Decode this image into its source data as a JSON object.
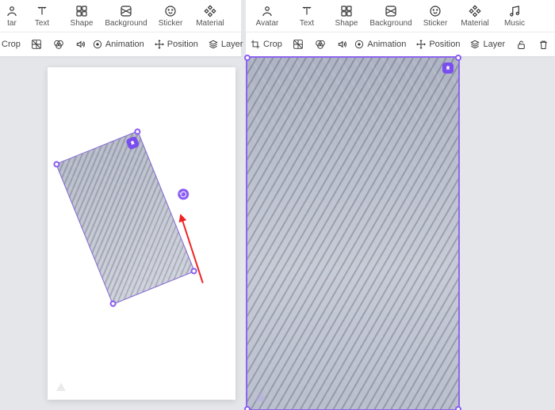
{
  "toolbar": {
    "avatar": "Avatar",
    "text": "Text",
    "shape": "Shape",
    "background": "Background",
    "sticker": "Sticker",
    "material": "Material",
    "music": "Music"
  },
  "row2": {
    "crop": "Crop",
    "animation": "Animation",
    "position": "Position",
    "layer": "Layer"
  },
  "icons": {
    "left_edge": "tar"
  },
  "colors": {
    "accent": "#8a5cf3",
    "arrow": "#e22222"
  }
}
